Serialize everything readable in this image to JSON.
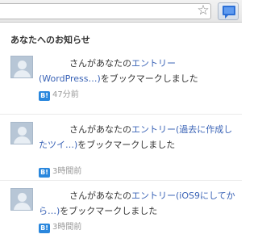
{
  "popup": {
    "heading": "あなたへのお知らせ"
  },
  "notifications": [
    {
      "prefix": "さんがあなたの",
      "link": "エントリー (WordPress…)",
      "suffix": "をブックマークしました",
      "badge": "B!",
      "time": "47分前"
    },
    {
      "prefix": "さんがあなたの",
      "link": "エントリー(過去に作成したツイ…)",
      "suffix": "をブックマークしました",
      "badge": "B!",
      "time": "3時間前"
    },
    {
      "prefix": "さんがあなたの",
      "link": "エントリー(iOS9にしてから…)",
      "suffix": "をブックマークしました",
      "badge": "B!",
      "time": "3時間前"
    }
  ],
  "toolbar": {
    "star_icon": "☆",
    "extension_icon": "speech-bubble-icon"
  },
  "colors": {
    "link": "#3a63b6",
    "badge": "#2a87dd",
    "muted": "#999999"
  }
}
